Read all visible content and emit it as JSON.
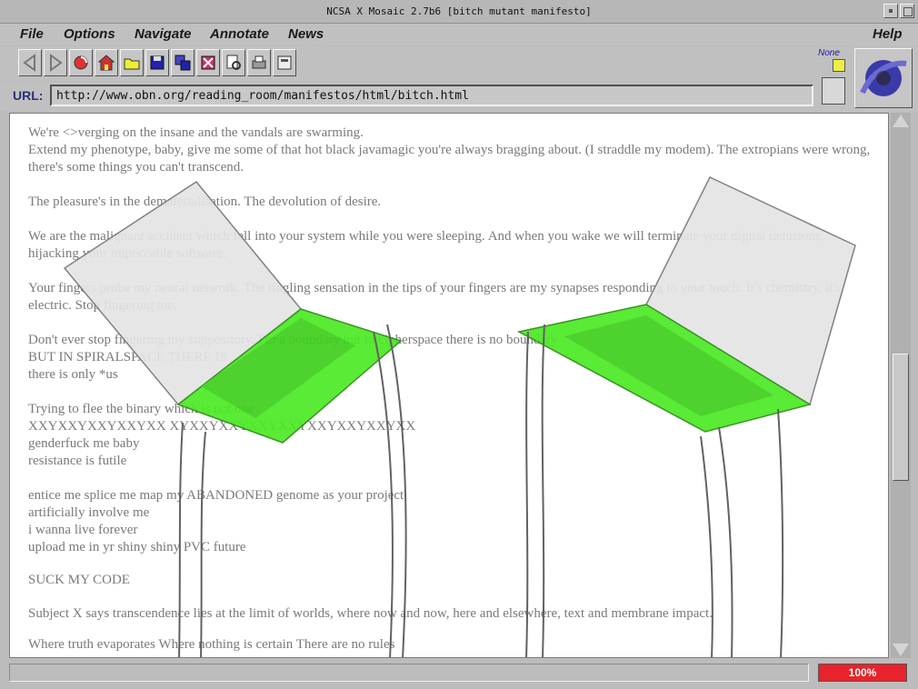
{
  "window": {
    "title": "NCSA X Mosaic 2.7b6 [bitch mutant manifesto]"
  },
  "menubar": {
    "file": "File",
    "options": "Options",
    "navigate": "Navigate",
    "annotate": "Annotate",
    "news": "News",
    "help": "Help"
  },
  "toolbar": {
    "buttons": [
      "back-icon",
      "forward-icon",
      "reload-icon",
      "home-icon",
      "open-icon",
      "save-icon",
      "clone-icon",
      "close-window-icon",
      "find-icon",
      "print-icon",
      "newsgroup-icon"
    ]
  },
  "url": {
    "label": "URL:",
    "value": "http://www.obn.org/reading_room/manifestos/html/bitch.html"
  },
  "status": {
    "none_label": "None",
    "progress": "100%"
  },
  "content": {
    "paragraphs": [
      "We're <>verging on the insane and the vandals are swarming.\nExtend my phenotype, baby, give me some of that hot black javamagic you're always bragging about. (I straddle my modem). The extropians were wrong, there's some things you can't transcend.",
      "The pleasure's in the dematerialisation. The devolution of desire.",
      "We are the malignant accident which fell into your system while you were sleeping. And when you wake we will terminate your digital delusions, hijacking your impeccable software.",
      "Your fingers probe my neural network. The tingling sensation in the tips of your fingers are my synapses responding to your touch. It's chemistry, it's electric. Stop fingering me.",
      "Don't ever stop fingering my suppository. I'm a boundary but in cipherspace there is no boundary\nBUT IN SPIRALSPACE THERE IS\nthere is only *us",
      "Trying to flee the binary which is not one\nXXYXXYXXYXXYXX XYXXYXXYXXYXXYXXYXXYXXYXX\ngenderfuck me baby\nresistance is futile",
      "entice me splice me map my ABANDONED genome as your project\nartificially involve me\ni wanna live forever\nupload me in yr shiny shiny PVC future",
      "SUCK MY CODE",
      "Subject X says transcendence lies at the limit of worlds, where now and now, here and elsewhere, text and membrane impact.",
      "Where truth evaporates Where nothing is certain There are no rules"
    ]
  }
}
